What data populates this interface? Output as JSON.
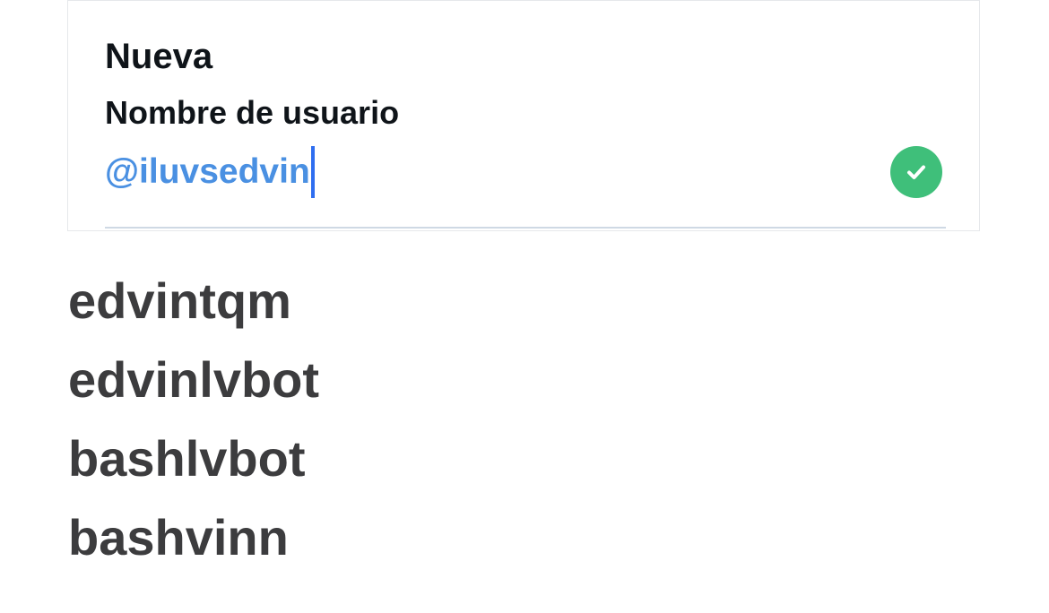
{
  "card": {
    "title": "Nueva",
    "field_label": "Nombre de usuario",
    "username_value": "@iluvsedvin"
  },
  "status": {
    "icon": "check-circle-icon",
    "color": "#3fbf7a"
  },
  "colors": {
    "input_text": "#4a90e2",
    "caret": "#2f6ef0"
  },
  "suggestions": [
    "edvintqm",
    "edvinlvbot",
    "bashlvbot",
    "bashvinn"
  ]
}
